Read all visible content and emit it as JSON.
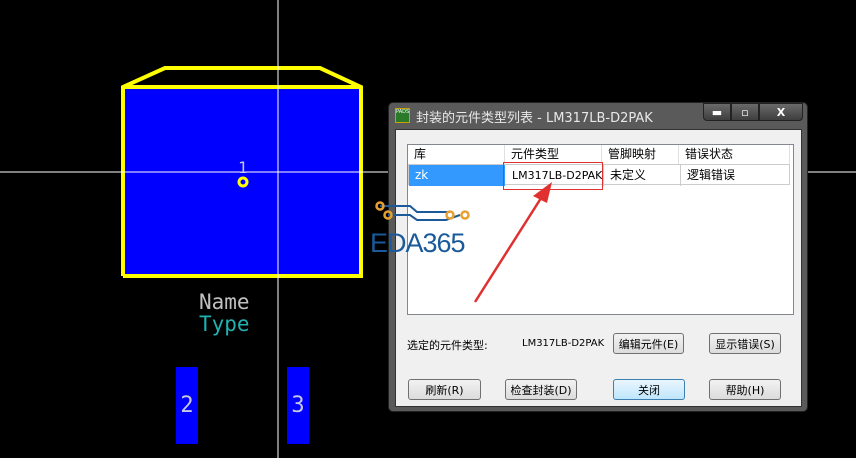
{
  "canvas": {
    "pad1_label": "1",
    "pad2_label": "2",
    "pad3_label": "3",
    "name_label": "Name",
    "type_label": "Type"
  },
  "watermark": "EDA365",
  "dialog": {
    "app_icon": "PADS",
    "title": "封装的元件类型列表 - LM317LB-D2PAK",
    "minimize": "▬",
    "maximize": "▫",
    "close": "X",
    "columns": [
      "库",
      "元件类型",
      "管脚映射",
      "错误状态"
    ],
    "rows": [
      [
        "zk",
        "LM317LB-D2PAK",
        "未定义",
        "逻辑错误"
      ]
    ],
    "selected_label": "选定的元件类型:",
    "selected_value": "LM317LB-D2PAK",
    "buttons": {
      "edit": "编辑元件(E)",
      "show_errors": "显示错误(S)",
      "refresh": "刷新(R)",
      "check": "检查封装(D)",
      "close": "关闭",
      "help": "帮助(H)"
    }
  },
  "colors": {
    "pad": "#0000ff",
    "outline": "#ffff00",
    "highlight": "#e03030",
    "selection": "#3399ff"
  }
}
